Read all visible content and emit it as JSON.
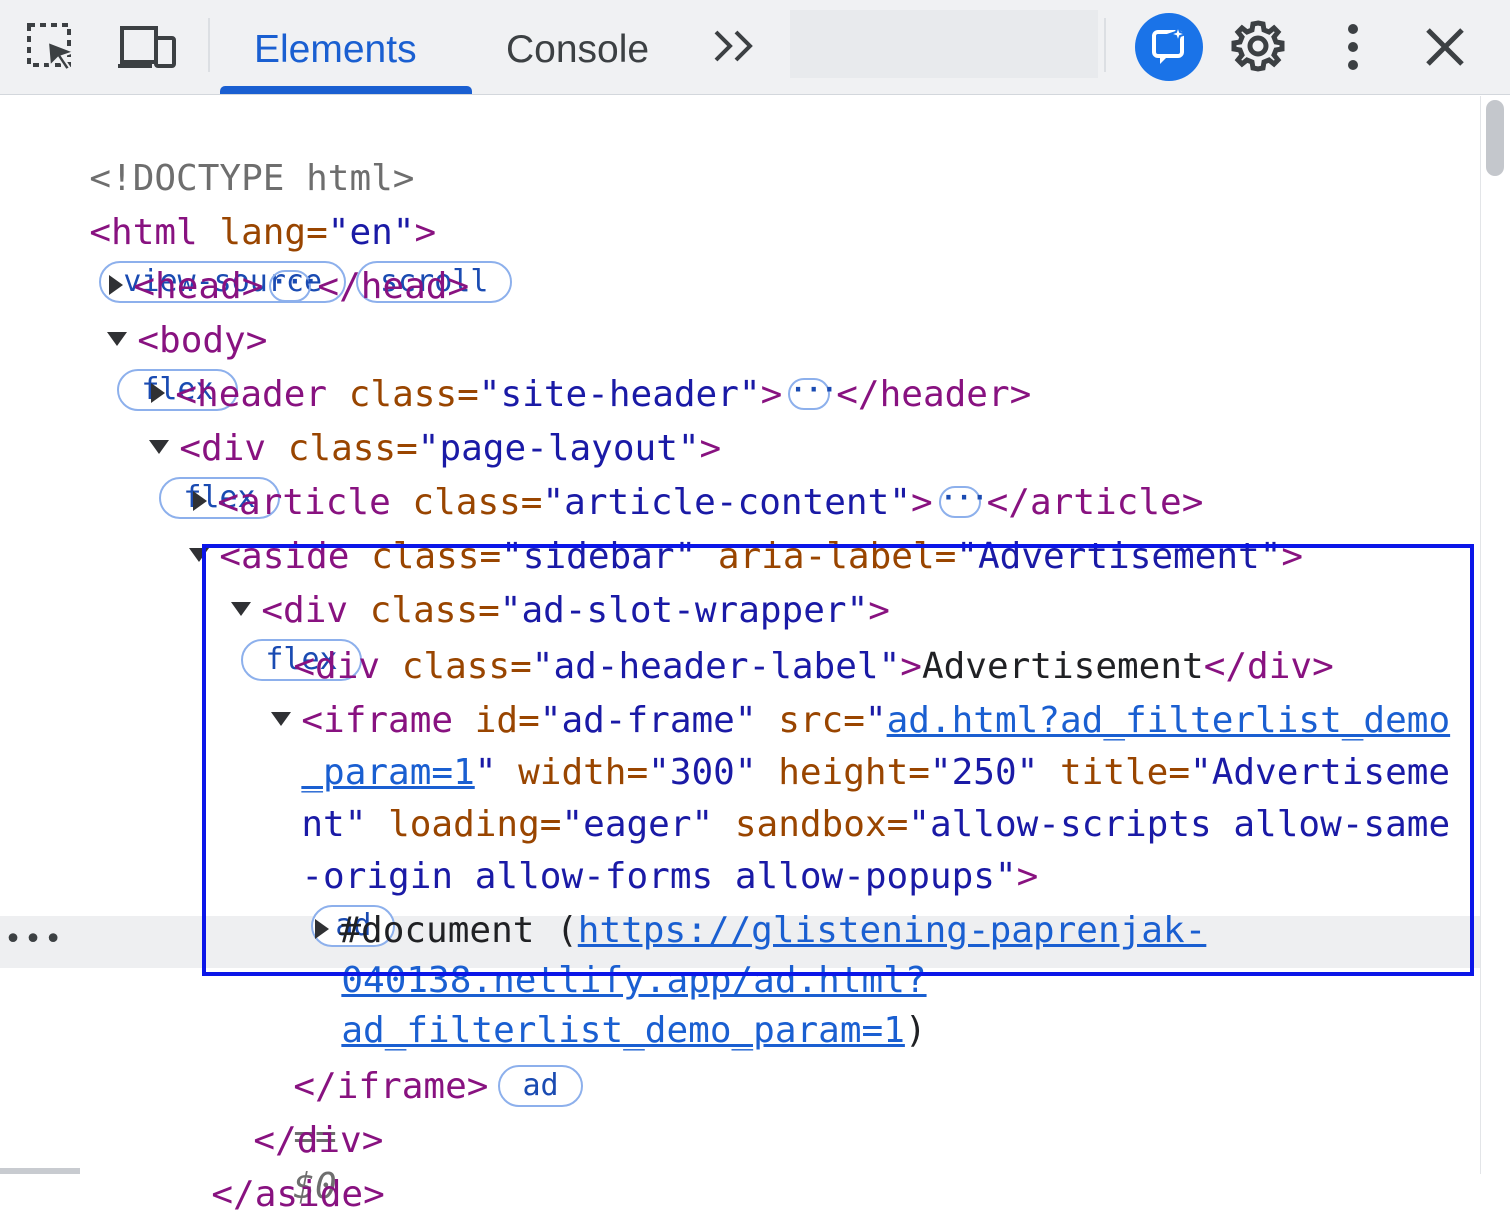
{
  "toolbar": {
    "tabs": [
      {
        "label": "Elements",
        "active": true
      },
      {
        "label": "Console",
        "active": false
      }
    ],
    "more_tabs": "»",
    "icons": [
      "element-picker-icon",
      "device-toolbar-icon",
      "ai-assistant-icon",
      "settings-gear-icon",
      "more-vertical-icon",
      "close-icon"
    ],
    "accent_color": "#1a5fd1"
  },
  "tree": {
    "doctype": "<!DOCTYPE html>",
    "html": {
      "open": "<html",
      "attr": " lang=",
      "val": "\"en\"",
      "close": ">",
      "badges": [
        "view-source",
        "scroll"
      ]
    },
    "head": {
      "open": "<head>",
      "close": "</head>"
    },
    "body": {
      "open": "<body>",
      "badge": "flex"
    },
    "header": {
      "open": "<header",
      "attr": " class=",
      "val": "\"site-header\"",
      "gt": ">",
      "close": "</header>"
    },
    "page_layout": {
      "open": "<div",
      "attr": " class=",
      "val": "\"page-layout\"",
      "gt": ">",
      "badge": "flex"
    },
    "article": {
      "open": "<article",
      "attr": " class=",
      "val": "\"article-content\"",
      "gt": ">",
      "close": "</article>"
    },
    "aside": {
      "open": "<aside",
      "attr1": " class=",
      "val1": "\"sidebar\"",
      "attr2": " aria-label=",
      "val2": "\"Advertisement\"",
      "gt": ">"
    },
    "ad_wrapper": {
      "open": "<div",
      "attr": " class=",
      "val": "\"ad-slot-wrapper\"",
      "gt": ">",
      "badge": "flex"
    },
    "ad_label": {
      "open": "<div",
      "attr": " class=",
      "val": "\"ad-header-label\"",
      "gt": ">",
      "text": "Advertisement",
      "close": "</div>"
    },
    "iframe": {
      "open": "<iframe",
      "a_id": " id=",
      "v_id": "\"ad-frame\"",
      "a_src": " src=",
      "q": "\"",
      "src_part1": "ad.html?ad_filterlist_demo",
      "src_part2": "_param=1",
      "a_width": " width=",
      "v_width": "\"300\"",
      "a_height": " height=",
      "v_height": "\"250\"",
      "a_title": " title=",
      "v_title1": "\"Advertiseme",
      "v_title2": "nt\"",
      "a_loading": " loading=",
      "v_loading": "\"eager\"",
      "a_sandbox": " sandbox=",
      "v_sandbox1": "\"allow-scripts allow-same",
      "v_sandbox2": "-origin allow-forms allow-popups\"",
      "gt": ">",
      "badge": "ad",
      "doc_label": "#document (",
      "doc_url1": "https://glistening-paprenjak-",
      "doc_url2": "040138.netlify.app/ad.html?",
      "doc_url3": "ad_filterlist_demo_param=1",
      "doc_close": ")",
      "close": "</iframe>",
      "close_badge": "ad",
      "eq": "==",
      "dollar": "$0"
    },
    "div_close": "</div>",
    "aside_close": "</aside>",
    "row_dots": "•••"
  }
}
